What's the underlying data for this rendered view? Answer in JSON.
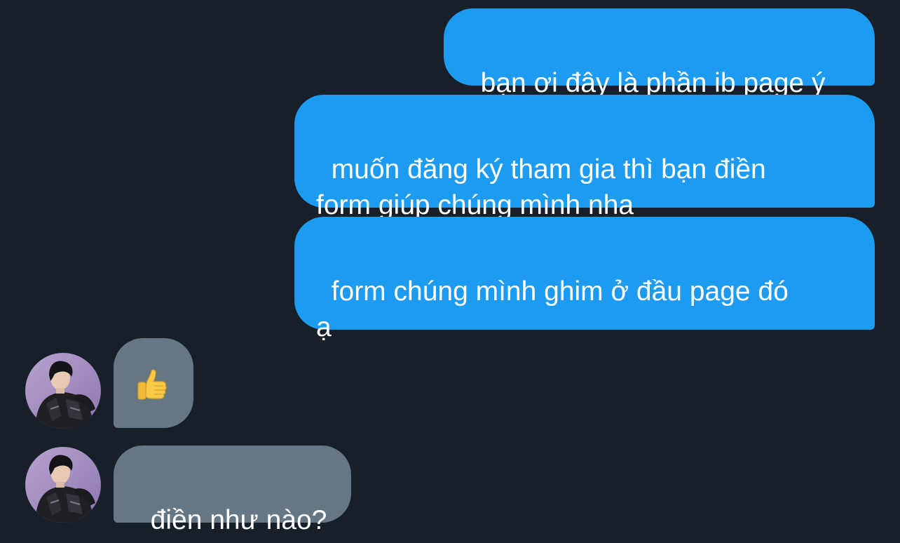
{
  "conversation": {
    "messages": [
      {
        "direction": "sent",
        "text": "bạn ơi đây là phần ib page ý"
      },
      {
        "direction": "sent",
        "text": "muốn đăng ký tham gia thì bạn điền\nform giúp chúng mình nha"
      },
      {
        "direction": "sent",
        "text": "form chúng mình ghim ở đầu page đó\nạ"
      },
      {
        "direction": "received",
        "emoji": "thumbs-up-icon"
      },
      {
        "direction": "received",
        "text": "điền như nào?"
      }
    ]
  },
  "colors": {
    "background": "#171f29",
    "sent_bubble": "#1d9bf0",
    "received_bubble": "#657685",
    "text": "#ffffff"
  }
}
